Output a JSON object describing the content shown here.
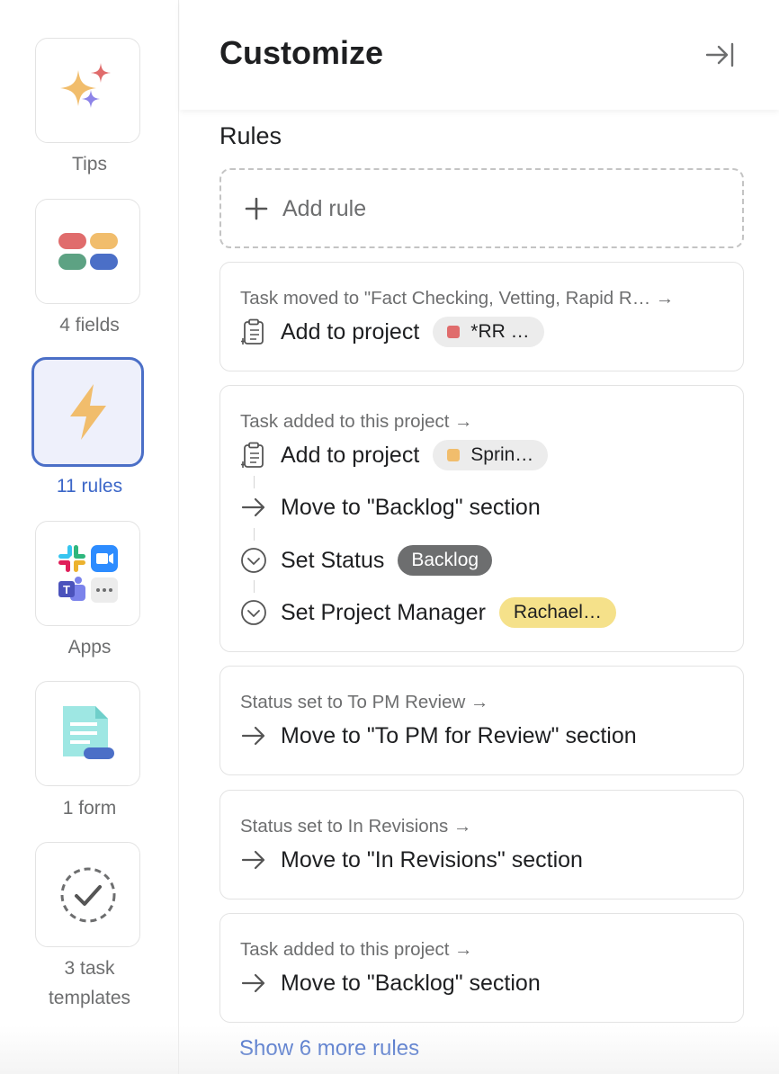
{
  "rail": {
    "items": [
      {
        "label": "Tips",
        "icon": "sparkles-icon"
      },
      {
        "label": "4 fields",
        "icon": "fields-icon"
      },
      {
        "label": "11 rules",
        "icon": "lightning-icon",
        "active": true
      },
      {
        "label": "Apps",
        "icon": "apps-grid-icon"
      },
      {
        "label": "1 form",
        "icon": "form-icon"
      },
      {
        "label_line1": "3 task",
        "label_line2": "templates",
        "icon": "task-template-icon"
      }
    ]
  },
  "header": {
    "title": "Customize",
    "collapse_icon": "collapse-panel-icon"
  },
  "rules_section": {
    "title": "Rules",
    "add_rule_label": "Add rule",
    "cards": [
      {
        "trigger": "Task moved to \"Fact Checking, Vetting, Rapid R…",
        "actions": [
          {
            "icon": "clipboard-add-icon",
            "label": "Add to project",
            "chip": "*RR …",
            "chip_color": "#e06c6c"
          }
        ]
      },
      {
        "trigger": "Task added to this project",
        "actions": [
          {
            "icon": "clipboard-add-icon",
            "label": "Add to project",
            "chip": "Sprin…",
            "chip_color": "#f1bd6c"
          },
          {
            "icon": "arrow-right-icon",
            "label": "Move to \"Backlog\" section"
          },
          {
            "icon": "dropdown-circle-icon",
            "label": "Set Status",
            "chip": "Backlog"
          },
          {
            "icon": "dropdown-circle-icon",
            "label": "Set Project Manager",
            "chip": "Rachael…"
          }
        ]
      },
      {
        "trigger": "Status set to To PM Review",
        "actions": [
          {
            "icon": "arrow-right-icon",
            "label": "Move to \"To PM for Review\" section"
          }
        ]
      },
      {
        "trigger": "Status set to In Revisions",
        "actions": [
          {
            "icon": "arrow-right-icon",
            "label": "Move to \"In Revisions\" section"
          }
        ]
      },
      {
        "trigger": "Task added to this project",
        "actions": [
          {
            "icon": "arrow-right-icon",
            "label": "Move to \"Backlog\" section"
          }
        ]
      }
    ],
    "show_more_label": "Show 6 more rules"
  },
  "colors": {
    "accent": "#3b66c8",
    "active_tile_bg": "#eef0fb",
    "status_chip_bg": "#6d6e6f",
    "person_chip_bg": "#f5e18a"
  }
}
